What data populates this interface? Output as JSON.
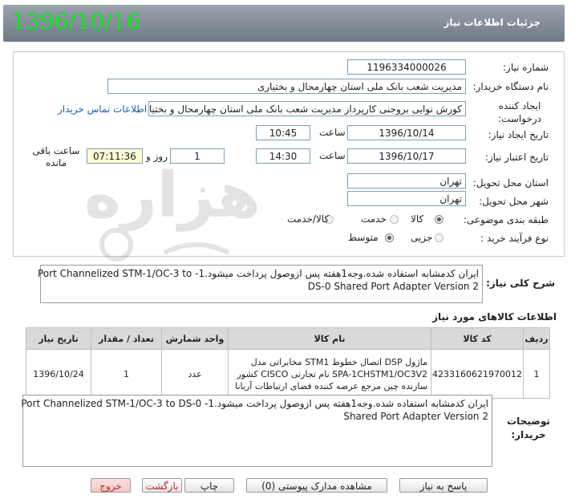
{
  "header": {
    "title": "جزئیات اطلاعات نیاز",
    "date": "1396/10/16"
  },
  "form": {
    "need_number_label": "شماره نیاز:",
    "need_number": "1196334000026",
    "buyer_label": "نام دستگاه خریدار:",
    "buyer": "مدیریت شعب بانک ملی استان چهارمحال و بختیاری",
    "requester_label": "ایجاد کننده درخواست:",
    "requester": "کورش نوایی بروجنی کارپرداز مدیریت شعب بانک ملی استان چهارمحال و بختیاری",
    "contact_link": "اطلاعات تماس خریدار",
    "created_label": "تاریخ ایجاد نیاز:",
    "created_date": "1396/10/14",
    "time_label": "ساعت",
    "created_time": "10:45",
    "validity_label": "تاریخ اعتبار نیاز:",
    "validity_date": "1396/10/17",
    "validity_time": "14:30",
    "days_value": "1",
    "days_label": "روز و",
    "remaining_time": "07:11:36",
    "remaining_label": "ساعت باقی مانده",
    "province_label": "استان محل تحویل:",
    "province": "تهران",
    "city_label": "شهر محل تحویل:",
    "city": "تهران",
    "category_label": "طبقه بندی موضوعی:",
    "category_options": [
      "کالا",
      "خدمت",
      "کالا/خدمت"
    ],
    "category_selected": "کالا",
    "process_label": "نوع فرآیند خرید :",
    "process_options": [
      "جزیی",
      "متوسط"
    ],
    "process_selected": "متوسط"
  },
  "general_desc": {
    "label": "شرح کلی نیاز:",
    "line1": "ایران کدمشابه استفاده شده.وجه1هفته پس ازوصول پرداخت میشود.1- Port Channelized STM-1/OC-3 to",
    "line2": "DS-0 Shared Port Adapter Version 2"
  },
  "items": {
    "section_title": "اطلاعات کالاهای مورد نیاز",
    "columns": [
      "ردیف",
      "کد کالا",
      "نام کالا",
      "واحد شمارش",
      "تعداد / مقدار",
      "تاریخ نیاز"
    ],
    "rows": [
      {
        "row": "1",
        "code": "4233160621970012",
        "name": "ماژول DSP اتصال خطوط STM1 مخابراتی مدل SPA-1CHSTM1/OC3V2 نام تجارتی CISCO کشور سازنده چین مرجع عرضه کننده فضای ارتباطات آریانا",
        "unit": "عدد",
        "qty": "1",
        "date": "1396/10/24"
      }
    ]
  },
  "buyer_notes": {
    "label": "توضیحات خریدار:",
    "line1": "ایران کدمشابه استفاده شده.وجه1هفته پس ازوصول پرداخت میشود.1- Port Channelized STM-1/OC-3 to DS-0",
    "line2": "Shared Port Adapter Version 2"
  },
  "buttons": {
    "reply": "پاسخ به نیاز",
    "docs": "مشاهده مدارک پیوستی (0)",
    "print": "چاپ",
    "back": "بازگشت",
    "exit": "خروج"
  },
  "watermark_text": "هزاره"
}
